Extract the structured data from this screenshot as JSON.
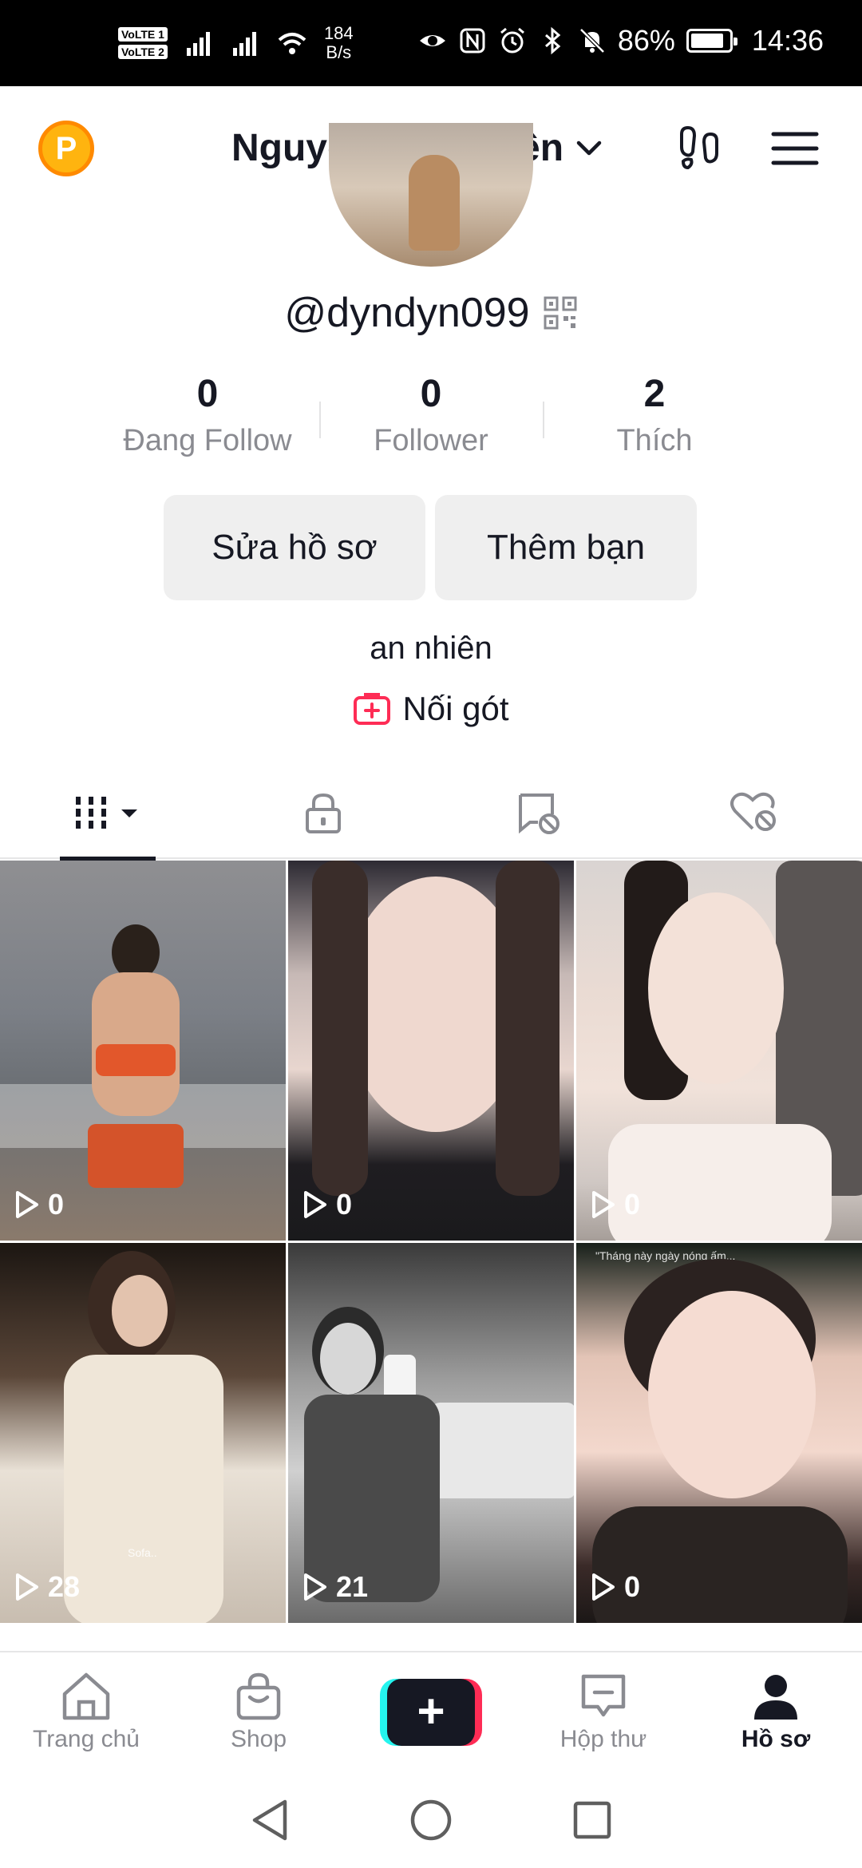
{
  "status_bar": {
    "volte1": "VoLTE 1",
    "volte2": "VoLTE 2",
    "net_speed_value": "184",
    "net_speed_unit": "B/s",
    "battery": "86%",
    "battery_level": 0.86,
    "time": "14:36"
  },
  "header": {
    "coin_letter": "P",
    "display_name": "Nguyễn Mỹ Duyên"
  },
  "profile": {
    "username": "@dyndyn099",
    "stats": [
      {
        "value": "0",
        "label": "Đang Follow"
      },
      {
        "value": "0",
        "label": "Follower"
      },
      {
        "value": "2",
        "label": "Thích"
      }
    ],
    "edit_button": "Sửa hồ sơ",
    "add_friend_button": "Thêm bạn",
    "bio": "an nhiên",
    "link_label": "Nối gót"
  },
  "videos": [
    {
      "views": "0"
    },
    {
      "views": "0"
    },
    {
      "views": "0"
    },
    {
      "views": "28"
    },
    {
      "views": "21"
    },
    {
      "views": "0"
    }
  ],
  "video_overlay_texts": {
    "v4": "Sofa..",
    "v6": "\"Tháng này ngày nóng ấm..."
  },
  "bottom_nav": {
    "home": "Trang chủ",
    "shop": "Shop",
    "inbox": "Hộp thư",
    "profile": "Hồ sơ"
  },
  "colors": {
    "accent_pink": "#fe2c55",
    "accent_cyan": "#25f4ee",
    "text_primary": "#161823",
    "text_secondary": "#8a8b91",
    "coin": "#ffb40f"
  }
}
